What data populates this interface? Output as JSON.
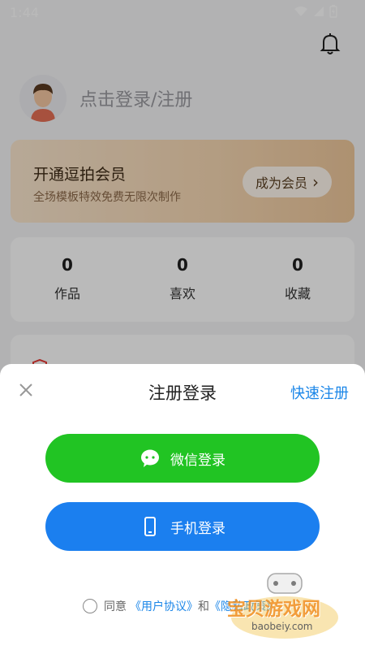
{
  "status": {
    "time": "1:44"
  },
  "profile": {
    "login_text": "点击登录/注册"
  },
  "vip": {
    "title": "开通逗拍会员",
    "subtitle": "全场模板特效免费无限次制作",
    "button": "成为会员",
    "button_arrow": "›"
  },
  "stats": [
    {
      "value": "0",
      "label": "作品"
    },
    {
      "value": "0",
      "label": "喜欢"
    },
    {
      "value": "0",
      "label": "收藏"
    }
  ],
  "sheet": {
    "title": "注册登录",
    "quick_register": "快速注册",
    "wechat_login": "微信登录",
    "phone_login": "手机登录",
    "agree_prefix": "同意",
    "user_agreement": "《用户协议》",
    "and": "和",
    "privacy_policy": "《隐私政策》"
  },
  "watermark": {
    "text": "宝贝游戏网",
    "url": "baobeiy.com"
  },
  "colors": {
    "wechat_green": "#21c423",
    "phone_blue": "#1b7fef",
    "link_blue": "#1b86e8"
  }
}
